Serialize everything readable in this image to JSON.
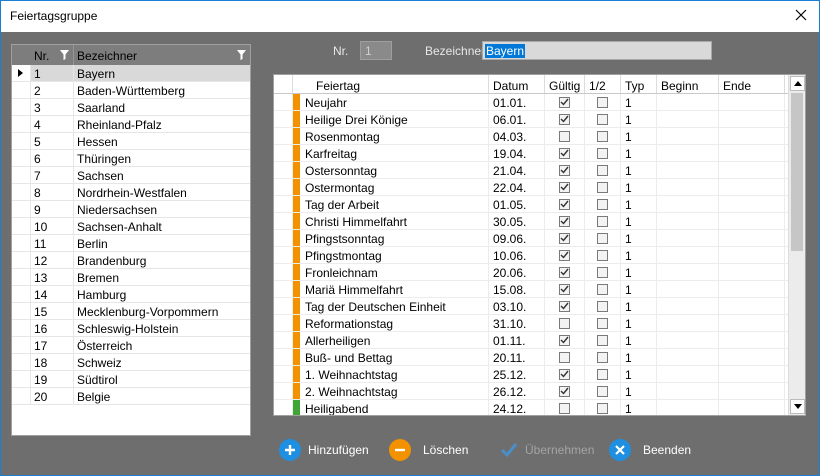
{
  "window": {
    "title": "Feiertagsgruppe"
  },
  "groups": {
    "headers": {
      "nr": "Nr.",
      "bez": "Bezeichner"
    },
    "rows": [
      {
        "nr": "1",
        "name": "Bayern",
        "selected": true
      },
      {
        "nr": "2",
        "name": "Baden-Württemberg"
      },
      {
        "nr": "3",
        "name": "Saarland"
      },
      {
        "nr": "4",
        "name": "Rheinland-Pfalz"
      },
      {
        "nr": "5",
        "name": "Hessen"
      },
      {
        "nr": "6",
        "name": "Thüringen"
      },
      {
        "nr": "7",
        "name": "Sachsen"
      },
      {
        "nr": "8",
        "name": "Nordrhein-Westfalen"
      },
      {
        "nr": "9",
        "name": "Niedersachsen"
      },
      {
        "nr": "10",
        "name": "Sachsen-Anhalt"
      },
      {
        "nr": "11",
        "name": "Berlin"
      },
      {
        "nr": "12",
        "name": "Brandenburg"
      },
      {
        "nr": "13",
        "name": "Bremen"
      },
      {
        "nr": "14",
        "name": "Hamburg"
      },
      {
        "nr": "15",
        "name": "Mecklenburg-Vorpommern"
      },
      {
        "nr": "16",
        "name": "Schleswig-Holstein"
      },
      {
        "nr": "17",
        "name": "Österreich"
      },
      {
        "nr": "18",
        "name": "Schweiz"
      },
      {
        "nr": "19",
        "name": "Südtirol"
      },
      {
        "nr": "20",
        "name": "Belgie"
      }
    ]
  },
  "form": {
    "nr_label": "Nr.",
    "nr_value": "1",
    "bez_label": "Bezeichner",
    "bez_value": "Bayern"
  },
  "holidays": {
    "headers": {
      "name": "Feiertag",
      "datum": "Datum",
      "gultig": "Gültig",
      "half": "1/2",
      "typ": "Typ",
      "beginn": "Beginn",
      "ende": "Ende"
    },
    "rows": [
      {
        "name": "Neujahr",
        "datum": "01.01.",
        "gultig": true,
        "half": false,
        "typ": "1",
        "color": "#f39200"
      },
      {
        "name": "Heilige Drei Könige",
        "datum": "06.01.",
        "gultig": true,
        "half": false,
        "typ": "1",
        "color": "#f39200"
      },
      {
        "name": "Rosenmontag",
        "datum": "04.03.",
        "gultig": false,
        "half": false,
        "typ": "1",
        "color": "#f39200"
      },
      {
        "name": "Karfreitag",
        "datum": "19.04.",
        "gultig": true,
        "half": false,
        "typ": "1",
        "color": "#f39200"
      },
      {
        "name": "Ostersonntag",
        "datum": "21.04.",
        "gultig": true,
        "half": false,
        "typ": "1",
        "color": "#f39200"
      },
      {
        "name": "Ostermontag",
        "datum": "22.04.",
        "gultig": true,
        "half": false,
        "typ": "1",
        "color": "#f39200"
      },
      {
        "name": "Tag der Arbeit",
        "datum": "01.05.",
        "gultig": true,
        "half": false,
        "typ": "1",
        "color": "#f39200"
      },
      {
        "name": "Christi Himmelfahrt",
        "datum": "30.05.",
        "gultig": true,
        "half": false,
        "typ": "1",
        "color": "#f39200"
      },
      {
        "name": "Pfingstsonntag",
        "datum": "09.06.",
        "gultig": true,
        "half": false,
        "typ": "1",
        "color": "#f39200"
      },
      {
        "name": "Pfingstmontag",
        "datum": "10.06.",
        "gultig": true,
        "half": false,
        "typ": "1",
        "color": "#f39200"
      },
      {
        "name": "Fronleichnam",
        "datum": "20.06.",
        "gultig": true,
        "half": false,
        "typ": "1",
        "color": "#f39200"
      },
      {
        "name": "Mariä Himmelfahrt",
        "datum": "15.08.",
        "gultig": true,
        "half": false,
        "typ": "1",
        "color": "#f39200"
      },
      {
        "name": "Tag der Deutschen Einheit",
        "datum": "03.10.",
        "gultig": true,
        "half": false,
        "typ": "1",
        "color": "#f39200"
      },
      {
        "name": "Reformationstag",
        "datum": "31.10.",
        "gultig": false,
        "half": false,
        "typ": "1",
        "color": "#f39200"
      },
      {
        "name": "Allerheiligen",
        "datum": "01.11.",
        "gultig": true,
        "half": false,
        "typ": "1",
        "color": "#f39200"
      },
      {
        "name": "Buß- und Bettag",
        "datum": "20.11.",
        "gultig": false,
        "half": false,
        "typ": "1",
        "color": "#f39200"
      },
      {
        "name": "1. Weihnachtstag",
        "datum": "25.12.",
        "gultig": true,
        "half": false,
        "typ": "1",
        "color": "#f39200"
      },
      {
        "name": "2. Weihnachtstag",
        "datum": "26.12.",
        "gultig": true,
        "half": false,
        "typ": "1",
        "color": "#f39200"
      },
      {
        "name": "Heiligabend",
        "datum": "24.12.",
        "gultig": false,
        "half": false,
        "typ": "1",
        "color": "#3fa535"
      }
    ]
  },
  "buttons": {
    "add": "Hinzufügen",
    "delete": "Löschen",
    "apply": "Übernehmen",
    "close": "Beenden"
  },
  "colors": {
    "accent_blue": "#1e8fe1",
    "accent_orange": "#f39200",
    "disabled_blue": "#4a8ec9"
  }
}
